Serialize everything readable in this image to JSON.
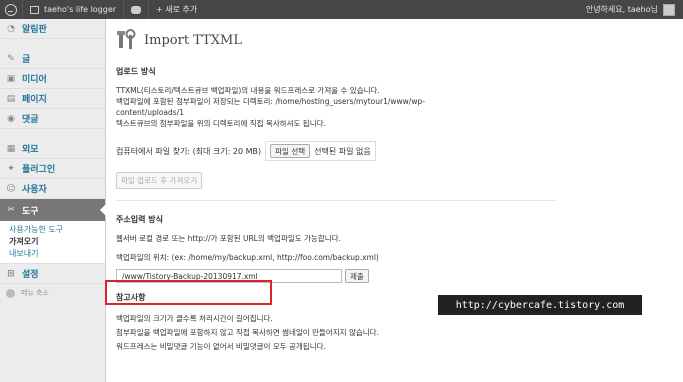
{
  "admin_bar": {
    "site_name": "taeho's life logger",
    "new_label": "+ 새로 추가",
    "greeting": "안녕하세요, taeho님"
  },
  "sidebar": {
    "items": [
      {
        "label": "알림판",
        "icon": "dashboard-icon"
      },
      {
        "label": "글",
        "icon": "pin-icon"
      },
      {
        "label": "미디어",
        "icon": "media-icon"
      },
      {
        "label": "페이지",
        "icon": "page-icon"
      },
      {
        "label": "댓글",
        "icon": "comment-icon"
      },
      {
        "label": "외모",
        "icon": "appearance-icon"
      },
      {
        "label": "플러그인",
        "icon": "plugin-icon"
      },
      {
        "label": "사용자",
        "icon": "users-icon"
      },
      {
        "label": "도구",
        "icon": "tools-icon"
      },
      {
        "label": "설정",
        "icon": "settings-icon"
      }
    ],
    "submenu": [
      "사용가능한 도구",
      "가져오기",
      "내보내기"
    ],
    "collapse_label": "메뉴 축소"
  },
  "page": {
    "title": "Import TTXML",
    "upload_section": {
      "heading": "업로드 방식",
      "line1": "TTXML(티스토리/텍스트큐브 백업파일)의 내용을 워드프레스로 가져올 수 있습니다.",
      "line2": "백업파일에 포함된 첨부파일이 저장되는 디렉토리: /home/hosting_users/mytour1/www/wp-",
      "line3": "content/uploads/1",
      "line4": "텍스트큐브의 첨부파일을 위의 디렉토리에 직접 복사하셔도 됩니다.",
      "file_label": "컴퓨터에서 파일 찾기: (최대 크기: 20 MB)",
      "file_button": "파일 선택",
      "file_status": "선택된 파일 없음",
      "submit_button": "파일 업로드 후 가져오기"
    },
    "url_section": {
      "heading": "주소입력 방식",
      "line1": "웹서버 로컬 경로 또는 http://가 포함된 URL의 백업파일도 가능합니다.",
      "location_label": "백업파일의 위치: (ex: /home/my/backup.xml, http://foo.com/backup.xml)",
      "url_value": "/www/Tistory-Backup-20130917.xml",
      "submit_button": "제출"
    },
    "notes_section": {
      "heading": "참고사항",
      "line1": "백업파일의 크기가 클수록 처리시간이 길어집니다.",
      "line2": "첨부파일을 백업파일에 포함하지 않고 직접 복사하면 썸네일이 만들어지지 않습니다.",
      "line3": "워드프레스는 비밀댓글 기능이 없어서 비밀댓글이 모두 공개됩니다."
    }
  },
  "watermark": "http://cybercafe.tistory.com",
  "colors": {
    "admin_bar": "#464646",
    "sidebar": "#ececec",
    "active_menu": "#777777",
    "link": "#21759b",
    "highlight_border": "#d9232d"
  }
}
